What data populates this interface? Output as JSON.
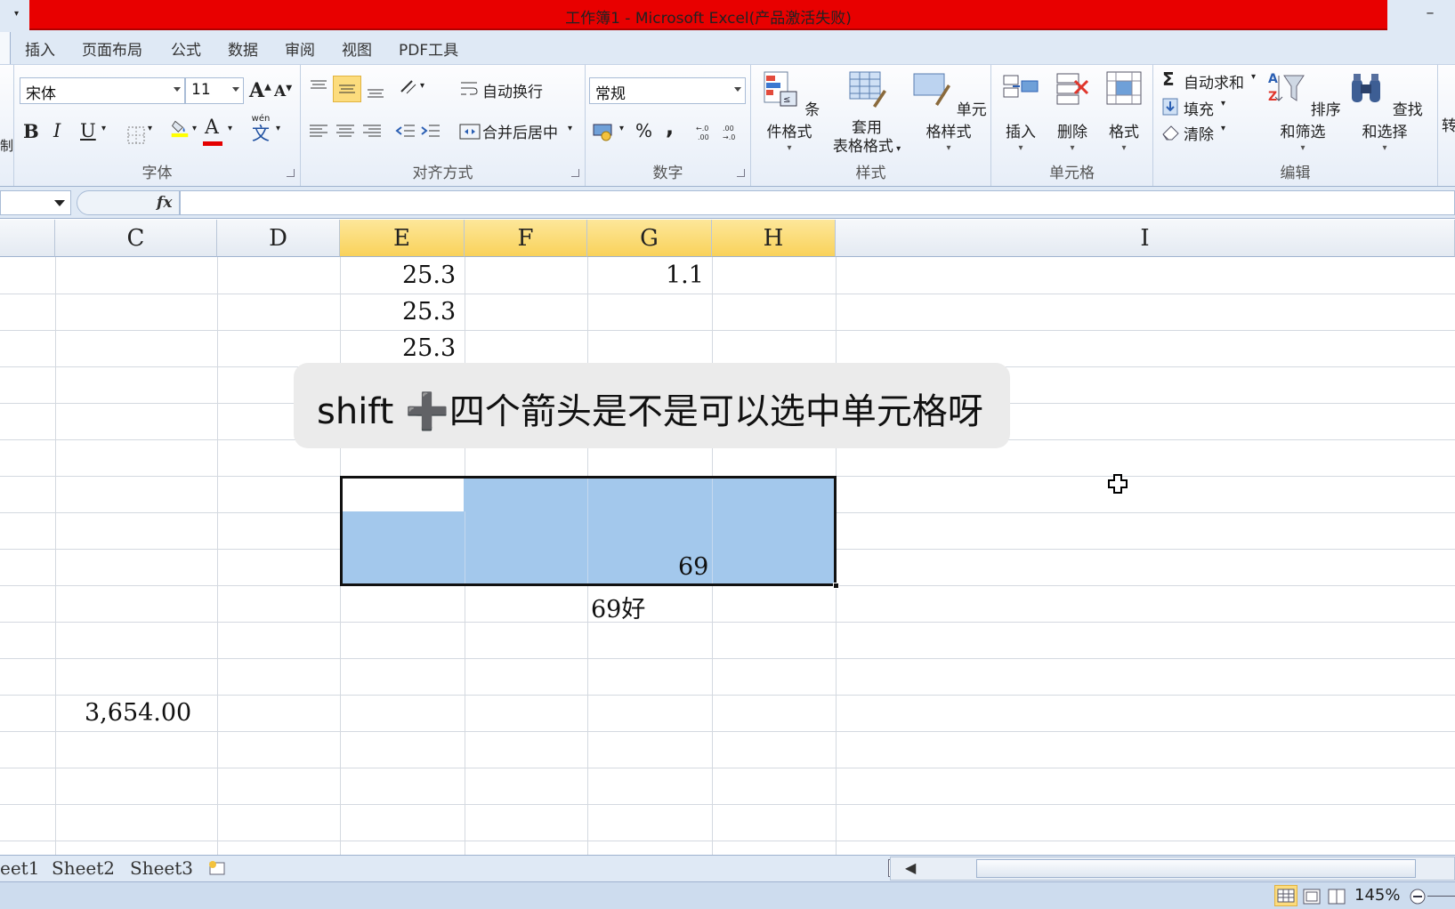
{
  "window": {
    "title": "工作簿1 - Microsoft Excel(产品激活失败)",
    "minimize_glyph": "–"
  },
  "tabs": [
    "插入",
    "页面布局",
    "公式",
    "数据",
    "审阅",
    "视图",
    "PDF工具"
  ],
  "ribbon": {
    "font": {
      "label": "字体",
      "name": "宋体",
      "size": "11",
      "grow": "A",
      "shrink": "A",
      "bold": "B",
      "italic": "I",
      "underline": "U",
      "fontcolor_letter": "A",
      "phonetic_top": "wén",
      "phonetic_char": "文",
      "left_stub": "制"
    },
    "alignment": {
      "label": "对齐方式",
      "wrap_text": "自动换行",
      "merge_center": "合并后居中"
    },
    "number": {
      "label": "数字",
      "format": "常规",
      "percent": "%",
      "comma": ","
    },
    "styles": {
      "label": "样式",
      "conditional": "条件格式",
      "table_line1": "套用",
      "table_line2": "表格格式",
      "cell_styles": "单元格样式"
    },
    "cells": {
      "label": "单元格",
      "insert": "插入",
      "delete": "删除",
      "format": "格式"
    },
    "editing": {
      "label": "编辑",
      "autosum": "自动求和",
      "fill": "填充",
      "clear": "清除",
      "sort_filter": "排序和筛选",
      "find_select": "查找和选择",
      "right_stub": "转"
    }
  },
  "formula_bar": {
    "fx": "fx"
  },
  "columns": [
    "C",
    "D",
    "E",
    "F",
    "G",
    "H",
    "I"
  ],
  "cells": {
    "e1": "25.3",
    "g1": "1.1",
    "e2": "25.3",
    "e3": "25.3",
    "g10": "69",
    "g11": "69好",
    "c14": "3,654.00"
  },
  "overlay": {
    "text": "shift ➕四个箭头是不是可以选中单元格呀"
  },
  "sheets": [
    "eet1",
    "Sheet2",
    "Sheet3"
  ],
  "status": {
    "zoom": "145%"
  },
  "colors": {
    "title_bar": "#e80000",
    "selection_fill": "#a3c8ec",
    "selected_header": "#f9d25a",
    "ribbon_bg": "#dfe9f5"
  }
}
